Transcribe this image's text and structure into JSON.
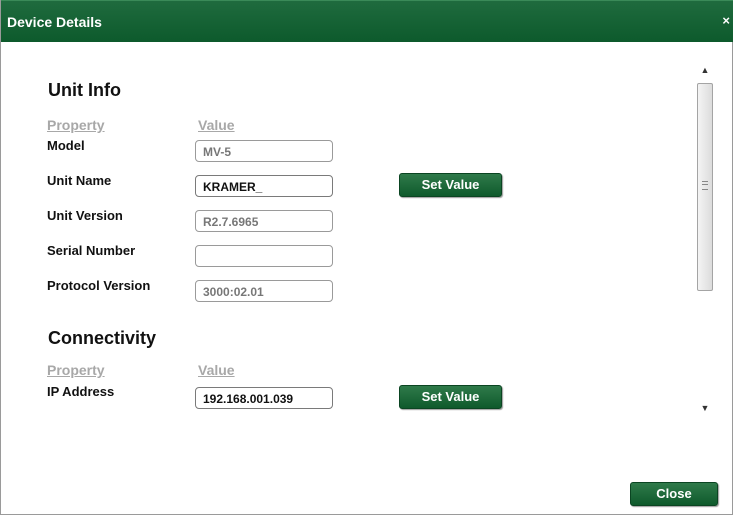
{
  "dialog": {
    "title": "Device Details",
    "close_glyph": "×"
  },
  "unit_info": {
    "title": "Unit Info",
    "property_header": "Property",
    "value_header": "Value",
    "rows": [
      {
        "label": "Model",
        "value": "MV-5",
        "editable": false
      },
      {
        "label": "Unit Name",
        "value": "KRAMER_",
        "editable": true
      },
      {
        "label": "Unit Version",
        "value": "R2.7.6965",
        "editable": false
      },
      {
        "label": "Serial Number",
        "value": "",
        "editable": false
      },
      {
        "label": "Protocol Version",
        "value": "3000:02.01",
        "editable": false
      }
    ],
    "set_value_label": "Set Value"
  },
  "connectivity": {
    "title": "Connectivity",
    "property_header": "Property",
    "value_header": "Value",
    "rows": [
      {
        "label": "IP Address",
        "value": "192.168.001.039",
        "editable": true
      }
    ],
    "set_value_label": "Set Value"
  },
  "footer": {
    "close_label": "Close"
  },
  "scrollbar": {
    "up_glyph": "▲",
    "down_glyph": "▼"
  },
  "colors": {
    "titlebar": "#0d5a2c",
    "button": "#1f6b3e",
    "column_header": "#a8a8a8"
  },
  "icons": [
    "close-icon",
    "scroll-up-arrow-icon",
    "scroll-down-arrow-icon",
    "scroll-grip-icon"
  ]
}
